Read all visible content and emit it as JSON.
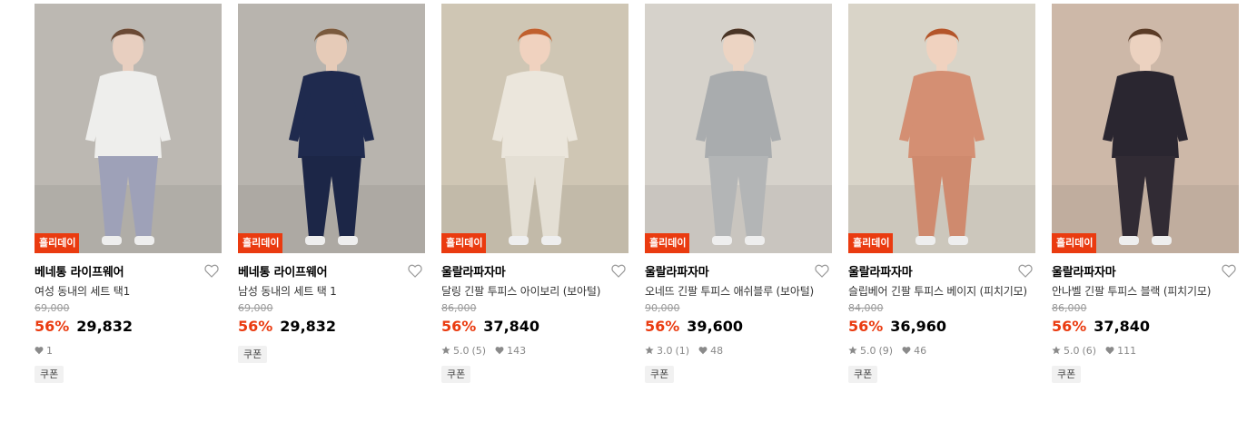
{
  "products": [
    {
      "badge": "홀리데이",
      "brand": "베네통 라이프웨어",
      "name": "여성 동내의 세트 택1",
      "original_price": "69,000",
      "discount": "56%",
      "price": "29,832",
      "rating": "",
      "reviews": "",
      "likes": "1",
      "coupon": "쿠폰",
      "image_desc": "woman in white top and lavender leggings",
      "colors": {
        "bg": "#bcb8b2",
        "top": "#eeeeec",
        "bottom": "#9ea1b8",
        "skin": "#e8cfc0",
        "hair": "#6b4a35"
      }
    },
    {
      "badge": "홀리데이",
      "brand": "베네통 라이프웨어",
      "name": "남성 동내의 세트 택 1",
      "original_price": "69,000",
      "discount": "56%",
      "price": "29,832",
      "rating": "",
      "reviews": "",
      "likes": "",
      "coupon": "쿠폰",
      "image_desc": "man in navy thermal set",
      "colors": {
        "bg": "#b8b4ae",
        "top": "#1f2a4e",
        "bottom": "#1c2647",
        "skin": "#e6cbb8",
        "hair": "#7a5a3d"
      }
    },
    {
      "badge": "홀리데이",
      "brand": "울랄라파자마",
      "name": "달링 긴팔 투피스 아이보리 (보아털)",
      "original_price": "86,000",
      "discount": "56%",
      "price": "37,840",
      "rating": "5.0",
      "reviews": "(5)",
      "likes": "143",
      "coupon": "쿠폰",
      "image_desc": "red-haired girl in ivory fleece pajamas with blue flowers",
      "colors": {
        "bg": "#cfc6b4",
        "top": "#ebe6dc",
        "bottom": "#e4dfd4",
        "skin": "#f0d2bf",
        "hair": "#c0602e"
      }
    },
    {
      "badge": "홀리데이",
      "brand": "울랄라파자마",
      "name": "오네뜨 긴팔 투피스 애쉬블루 (보아털)",
      "original_price": "90,000",
      "discount": "56%",
      "price": "39,600",
      "rating": "3.0",
      "reviews": "(1)",
      "likes": "48",
      "coupon": "쿠폰",
      "image_desc": "woman in grey fleece pajamas with lace bib",
      "colors": {
        "bg": "#d6d2cb",
        "top": "#a9acae",
        "bottom": "#b3b5b6",
        "skin": "#ecd4c3",
        "hair": "#4a3526"
      }
    },
    {
      "badge": "홀리데이",
      "brand": "울랄라파자마",
      "name": "슬립베어 긴팔 투피스 베이지 (피치기모)",
      "original_price": "84,000",
      "discount": "56%",
      "price": "36,960",
      "rating": "5.0",
      "reviews": "(9)",
      "likes": "46",
      "coupon": "쿠폰",
      "image_desc": "red-haired girl in pink floral pajamas on tiled floor",
      "colors": {
        "bg": "#d9d4c8",
        "top": "#d48f73",
        "bottom": "#cf8a6e",
        "skin": "#f0d2bf",
        "hair": "#b4552a"
      }
    },
    {
      "badge": "홀리데이",
      "brand": "울랄라파자마",
      "name": "안나벨 긴팔 투피스 블랙 (피치기모)",
      "original_price": "86,000",
      "discount": "56%",
      "price": "37,840",
      "rating": "5.0",
      "reviews": "(6)",
      "likes": "111",
      "coupon": "쿠폰",
      "image_desc": "woman in black floral pajamas on bed",
      "colors": {
        "bg": "#cdb8a8",
        "top": "#2a2630",
        "bottom": "#312b34",
        "skin": "#ecd2c0",
        "hair": "#5a3b26"
      }
    }
  ],
  "icons": {
    "heart": "heart-outline-icon",
    "star": "star-icon",
    "like": "heart-filled-icon"
  }
}
